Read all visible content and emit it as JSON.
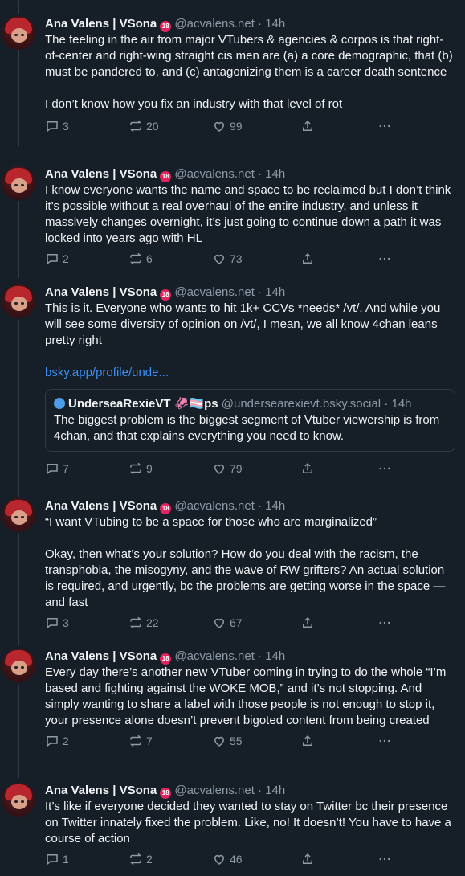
{
  "posts": [
    {
      "author": "Ana Valens | VSona",
      "badge": "18",
      "handle": "@acvalens.net",
      "time": "14h",
      "body": "The feeling in the air from major VTubers & agencies & corpos is that right-of-center and right-wing straight cis men are (a) a core demographic, that (b) must be pandered to, and (c) antagonizing them is a career death sentence\n\nI don’t know how you fix an industry with that level of rot",
      "replies": "3",
      "reposts": "20",
      "likes": "99"
    },
    {
      "author": "Ana Valens | VSona",
      "badge": "18",
      "handle": "@acvalens.net",
      "time": "14h",
      "body": "I know everyone wants the name and space to be reclaimed but I don’t think it’s possible without a real overhaul of the entire industry, and unless it massively changes overnight, it’s just going to continue down a path it was locked into years ago with HL",
      "replies": "2",
      "reposts": "6",
      "likes": "73"
    },
    {
      "author": "Ana Valens | VSona",
      "badge": "18",
      "handle": "@acvalens.net",
      "time": "14h",
      "body": "This is it. Everyone who wants to hit 1k+ CCVs *needs* /vt/. And while you will see some diversity of opinion on /vt/, I mean, we all know 4chan leans pretty right",
      "link": "bsky.app/profile/unde...",
      "quote": {
        "author": "UnderseaRexieVT 🦑🏳️‍⚧️ps",
        "handle": "@undersearexievt.bsky.social",
        "time": "14h",
        "body": "The biggest problem is the biggest segment of Vtuber viewership is from 4chan, and that explains everything you need to know."
      },
      "replies": "7",
      "reposts": "9",
      "likes": "79"
    },
    {
      "author": "Ana Valens | VSona",
      "badge": "18",
      "handle": "@acvalens.net",
      "time": "14h",
      "body": "“I want VTubing to be a space for those who are marginalized”\n\nOkay, then what’s your solution? How do you deal with the racism, the transphobia, the misogyny, and the wave of RW grifters? An actual solution is required, and urgently, bc the problems are getting worse in the space — and fast",
      "replies": "3",
      "reposts": "22",
      "likes": "67"
    },
    {
      "author": "Ana Valens | VSona",
      "badge": "18",
      "handle": "@acvalens.net",
      "time": "14h",
      "body": "Every day there’s another new VTuber coming in trying to do the whole “I’m based and fighting against the WOKE MOB,” and it’s not stopping. And simply wanting to share a label with those people is not enough to stop it, your presence alone doesn’t prevent bigoted content from being created",
      "replies": "2",
      "reposts": "7",
      "likes": "55"
    },
    {
      "author": "Ana Valens | VSona",
      "badge": "18",
      "handle": "@acvalens.net",
      "time": "14h",
      "body": "It’s like if everyone decided they wanted to stay on Twitter bc their presence on Twitter innately fixed the problem. Like, no! It doesn’t! You have to have a course of action",
      "replies": "1",
      "reposts": "2",
      "likes": "46"
    }
  ],
  "separator": "·",
  "colors": {
    "background": "#161e27",
    "muted": "#8d9aa8",
    "link": "#3d8ff2",
    "thread_line": "#2e3a47"
  },
  "icons": [
    "reply-icon",
    "repost-icon",
    "like-icon",
    "share-icon",
    "more-icon"
  ]
}
